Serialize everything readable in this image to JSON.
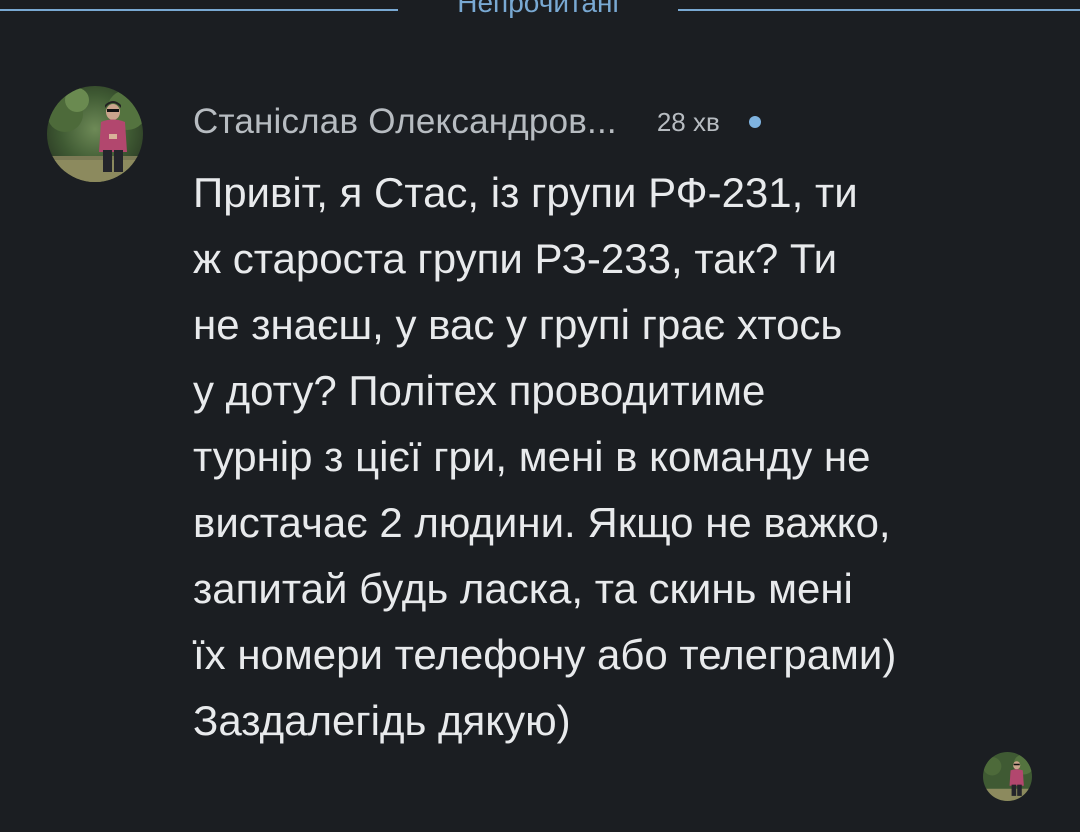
{
  "divider": {
    "label": "Непрочитані"
  },
  "message": {
    "sender": "Станіслав Олександров...",
    "time": "28 хв",
    "lines": [
      "Привіт, я Стас, із групи РФ-231, ти",
      "ж староста групи РЗ-233, так? Ти",
      "не знаєш, у вас у групі грає хтось",
      "у доту? Політех проводитиме",
      "турнір з цієї гри, мені в команду не",
      "вистачає 2 людини. Якщо не важко,",
      "запитай будь ласка, та скинь мені",
      "їх номери телефону або телеграми)",
      "Заздалегідь дякую)"
    ]
  },
  "colors": {
    "background": "#1b1e22",
    "accent": "#79a9d3",
    "unread_dot": "#7fb3e0",
    "meta_text": "#b7bcc1",
    "body_text": "#e8eaec"
  }
}
